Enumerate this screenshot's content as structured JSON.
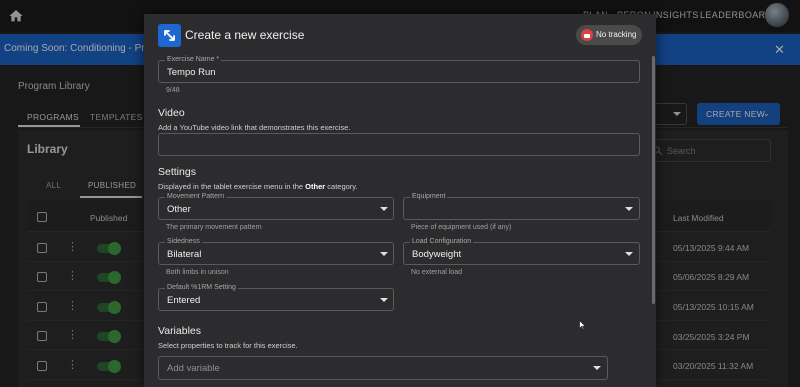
{
  "topbar": {
    "nav": [
      "PLAN",
      "PERON",
      "INSIGHTS",
      "LEADERBOARD"
    ]
  },
  "banner": {
    "text": "Coming Soon: Conditioning - Prog",
    "close_symbol": "✕"
  },
  "library_page": {
    "title": "Program Library",
    "tabs": [
      "PROGRAMS",
      "TEMPLATES"
    ],
    "create_button": "CREATE NEW",
    "search_placeholder": "Search",
    "section_title": "Library",
    "subtabs": [
      "ALL",
      "PUBLISHED"
    ],
    "columns": {
      "published": "Published",
      "last_modified": "Last Modified"
    },
    "rows": [
      {
        "published": true,
        "last_modified": "05/13/2025 9:44 AM"
      },
      {
        "published": true,
        "last_modified": "05/06/2025 8:29 AM"
      },
      {
        "published": true,
        "last_modified": "05/13/2025 10:15 AM"
      },
      {
        "published": true,
        "last_modified": "03/25/2025 3:24 PM"
      },
      {
        "published": true,
        "last_modified": "03/20/2025 11:32 AM"
      }
    ]
  },
  "modal": {
    "title": "Create a new exercise",
    "tracking_chip": "No tracking",
    "exercise_name": {
      "label": "Exercise Name *",
      "value": "Tempo Run",
      "counter": "9/48"
    },
    "video": {
      "heading": "Video",
      "description": "Add a YouTube video link that demonstrates this exercise.",
      "value": ""
    },
    "settings": {
      "heading": "Settings",
      "desc_prefix": "Displayed in the tablet exercise menu in the ",
      "desc_bold": "Other",
      "desc_suffix": " category.",
      "movement_pattern": {
        "label": "Movement Pattern",
        "value": "Other",
        "helper": "The primary movement pattern"
      },
      "equipment": {
        "label": "Equipment",
        "value": "",
        "helper": "Piece of equipment used (if any)"
      },
      "sidedness": {
        "label": "Sidedness",
        "value": "Bilateral",
        "helper": "Both limbs in unison"
      },
      "load_configuration": {
        "label": "Load Configuration",
        "value": "Bodyweight",
        "helper": "No external load"
      },
      "default_1rm": {
        "label": "Default %1RM Setting",
        "value": "Entered"
      }
    },
    "variables": {
      "heading": "Variables",
      "description": "Select properties to track for this exercise.",
      "placeholder": "Add variable"
    }
  },
  "colors": {
    "accent": "#1e66d0",
    "banner": "#1c66c9",
    "toggle_on": "#43a047",
    "chip_badge": "#d94343"
  },
  "icons": [
    "home-icon",
    "close-icon",
    "expand-arrows-icon",
    "no-tracking-icon",
    "search-icon",
    "chevron-down-icon",
    "kebab-menu-icon",
    "mouse-pointer-icon"
  ]
}
